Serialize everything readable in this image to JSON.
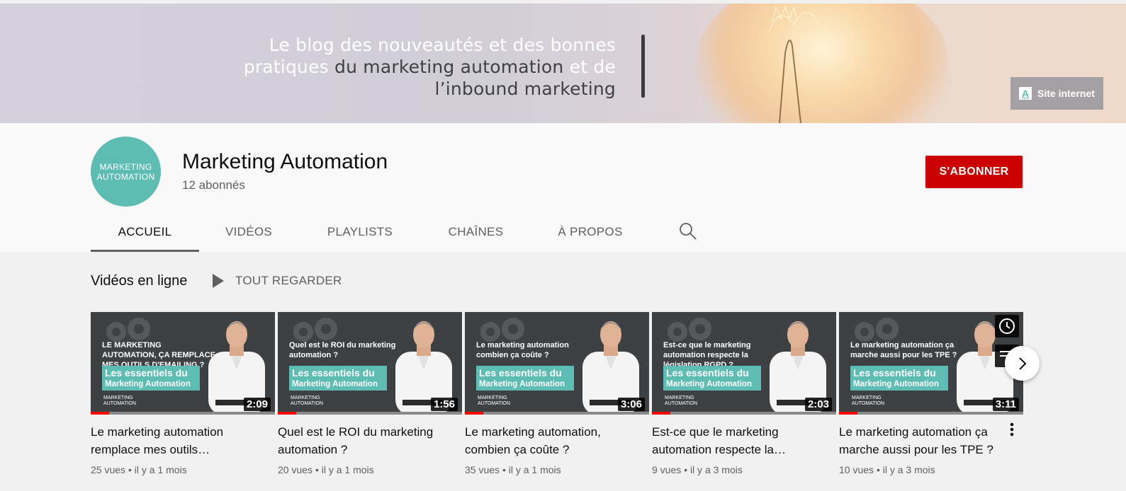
{
  "banner": {
    "line1": "Le blog des nouveautés et des bonnes",
    "line2_light": "pratiques ",
    "line2_dark": "du marketing automation",
    "line2_tail": " et de",
    "line3": "l’inbound marketing",
    "site_link_label": "Site internet",
    "site_icon": "A"
  },
  "channel": {
    "avatar_line1": "MARKETING",
    "avatar_line2": "AUTOMATION",
    "name": "Marketing Automation",
    "subscribers": "12 abonnés",
    "subscribe_label": "S'ABONNER"
  },
  "tabs": [
    {
      "label": "ACCUEIL",
      "active": true
    },
    {
      "label": "VIDÉOS",
      "active": false
    },
    {
      "label": "PLAYLISTS",
      "active": false
    },
    {
      "label": "CHAÎNES",
      "active": false
    },
    {
      "label": "À PROPOS",
      "active": false
    }
  ],
  "shelf": {
    "title": "Vidéos en ligne",
    "play_all_label": "TOUT REGARDER"
  },
  "thumb_common": {
    "box_line1": "Les essentiels du",
    "box_line2": "Marketing Automation",
    "mini_logo_1": "MARKETING",
    "mini_logo_2": "AUTOMATION"
  },
  "videos": [
    {
      "headline": "LE MARKETING AUTOMATION, ÇA REMPLACE MES OUTILS D'EMAILING ?",
      "duration": "2:09",
      "title": "Le marketing automation remplace mes outils…",
      "views": "25 vues",
      "age": "il y a 1 mois",
      "watched": 0.1
    },
    {
      "headline": "Quel est le ROI du marketing automation ?",
      "duration": "1:56",
      "title": "Quel est le ROI du marketing automation ?",
      "views": "20 vues",
      "age": "il y a 1 mois",
      "watched": 0.1
    },
    {
      "headline": "Le marketing automation combien ça coûte ?",
      "duration": "3:06",
      "title": "Le marketing automation, combien ça coûte ?",
      "views": "35 vues",
      "age": "il y a 1 mois",
      "watched": 0.1
    },
    {
      "headline": "Est-ce que le marketing automation respecte la législation RGPD ?",
      "duration": "2:03",
      "title": "Est-ce que le marketing automation respecte la…",
      "views": "9 vues",
      "age": "il y a 3 mois",
      "watched": 0.1
    },
    {
      "headline": "Le marketing automation ça marche aussi pour les TPE ?",
      "duration": "3:11",
      "title": "Le marketing automation ça marche aussi pour les TPE ?",
      "views": "10 vues",
      "age": "il y a 3 mois",
      "watched": 0.1
    }
  ],
  "colors": {
    "brand_teal": "#5dbdb3",
    "subscribe_red": "#cc0000",
    "progress_red": "#ff0000"
  },
  "icons": {
    "search": "search-icon",
    "play": "play-icon",
    "next": "chevron-right-icon",
    "watch_later": "clock-icon",
    "queue": "add-to-queue-icon",
    "more": "more-vert-icon"
  }
}
